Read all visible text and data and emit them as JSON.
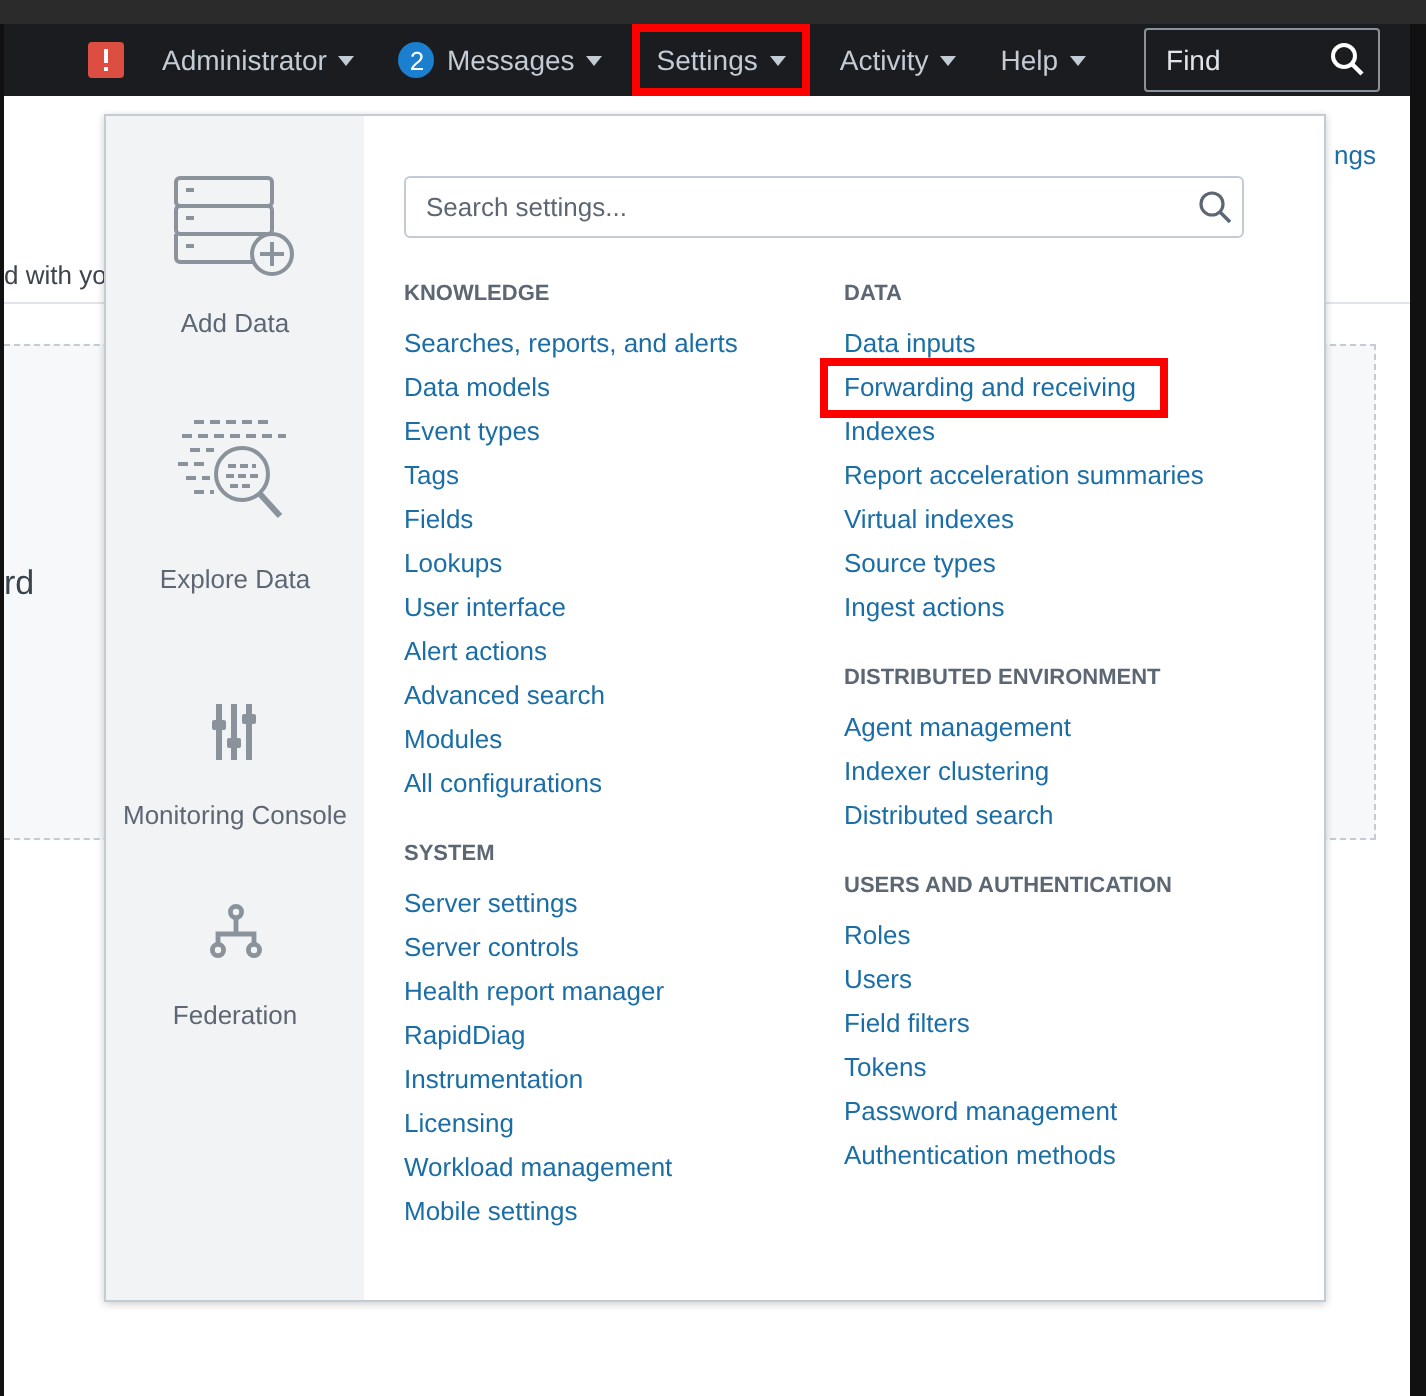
{
  "nav": {
    "items": [
      {
        "label": "Administrator",
        "highlighted": false
      },
      {
        "label": "Messages",
        "badge": "2",
        "highlighted": false
      },
      {
        "label": "Settings",
        "highlighted": true
      },
      {
        "label": "Activity",
        "highlighted": false
      },
      {
        "label": "Help",
        "highlighted": false
      }
    ],
    "find": {
      "placeholder": "Find"
    }
  },
  "background": {
    "intro_text": "d with yo",
    "card_text": "rd",
    "link_text": "ngs"
  },
  "menu": {
    "shortcuts": [
      {
        "label": "Add Data",
        "kind": "add"
      },
      {
        "label": "Explore Data",
        "kind": "explore"
      },
      {
        "label": "Monitoring Console",
        "kind": "monitor"
      },
      {
        "label": "Federation",
        "kind": "federation"
      }
    ],
    "search": {
      "placeholder": "Search settings..."
    },
    "columns": [
      {
        "sections": [
          {
            "title": "KNOWLEDGE",
            "links": [
              {
                "label": "Searches, reports, and alerts",
                "highlighted": false
              },
              {
                "label": "Data models",
                "highlighted": false
              },
              {
                "label": "Event types",
                "highlighted": false
              },
              {
                "label": "Tags",
                "highlighted": false
              },
              {
                "label": "Fields",
                "highlighted": false
              },
              {
                "label": "Lookups",
                "highlighted": false
              },
              {
                "label": "User interface",
                "highlighted": false
              },
              {
                "label": "Alert actions",
                "highlighted": false
              },
              {
                "label": "Advanced search",
                "highlighted": false
              },
              {
                "label": "Modules",
                "highlighted": false
              },
              {
                "label": "All configurations",
                "highlighted": false
              }
            ]
          },
          {
            "title": "SYSTEM",
            "links": [
              {
                "label": "Server settings",
                "highlighted": false
              },
              {
                "label": "Server controls",
                "highlighted": false
              },
              {
                "label": "Health report manager",
                "highlighted": false
              },
              {
                "label": "RapidDiag",
                "highlighted": false
              },
              {
                "label": "Instrumentation",
                "highlighted": false
              },
              {
                "label": "Licensing",
                "highlighted": false
              },
              {
                "label": "Workload management",
                "highlighted": false
              },
              {
                "label": "Mobile settings",
                "highlighted": false
              }
            ]
          }
        ]
      },
      {
        "sections": [
          {
            "title": "DATA",
            "links": [
              {
                "label": "Data inputs",
                "highlighted": false
              },
              {
                "label": "Forwarding and receiving",
                "highlighted": true
              },
              {
                "label": "Indexes",
                "highlighted": false
              },
              {
                "label": "Report acceleration summaries",
                "highlighted": false
              },
              {
                "label": "Virtual indexes",
                "highlighted": false
              },
              {
                "label": "Source types",
                "highlighted": false
              },
              {
                "label": "Ingest actions",
                "highlighted": false
              }
            ]
          },
          {
            "title": "DISTRIBUTED ENVIRONMENT",
            "links": [
              {
                "label": "Agent management",
                "highlighted": false
              },
              {
                "label": "Indexer clustering",
                "highlighted": false
              },
              {
                "label": "Distributed search",
                "highlighted": false
              }
            ]
          },
          {
            "title": "USERS AND AUTHENTICATION",
            "links": [
              {
                "label": "Roles",
                "highlighted": false
              },
              {
                "label": "Users",
                "highlighted": false
              },
              {
                "label": "Field filters",
                "highlighted": false
              },
              {
                "label": "Tokens",
                "highlighted": false
              },
              {
                "label": "Password management",
                "highlighted": false
              },
              {
                "label": "Authentication methods",
                "highlighted": false
              }
            ]
          }
        ]
      }
    ]
  }
}
